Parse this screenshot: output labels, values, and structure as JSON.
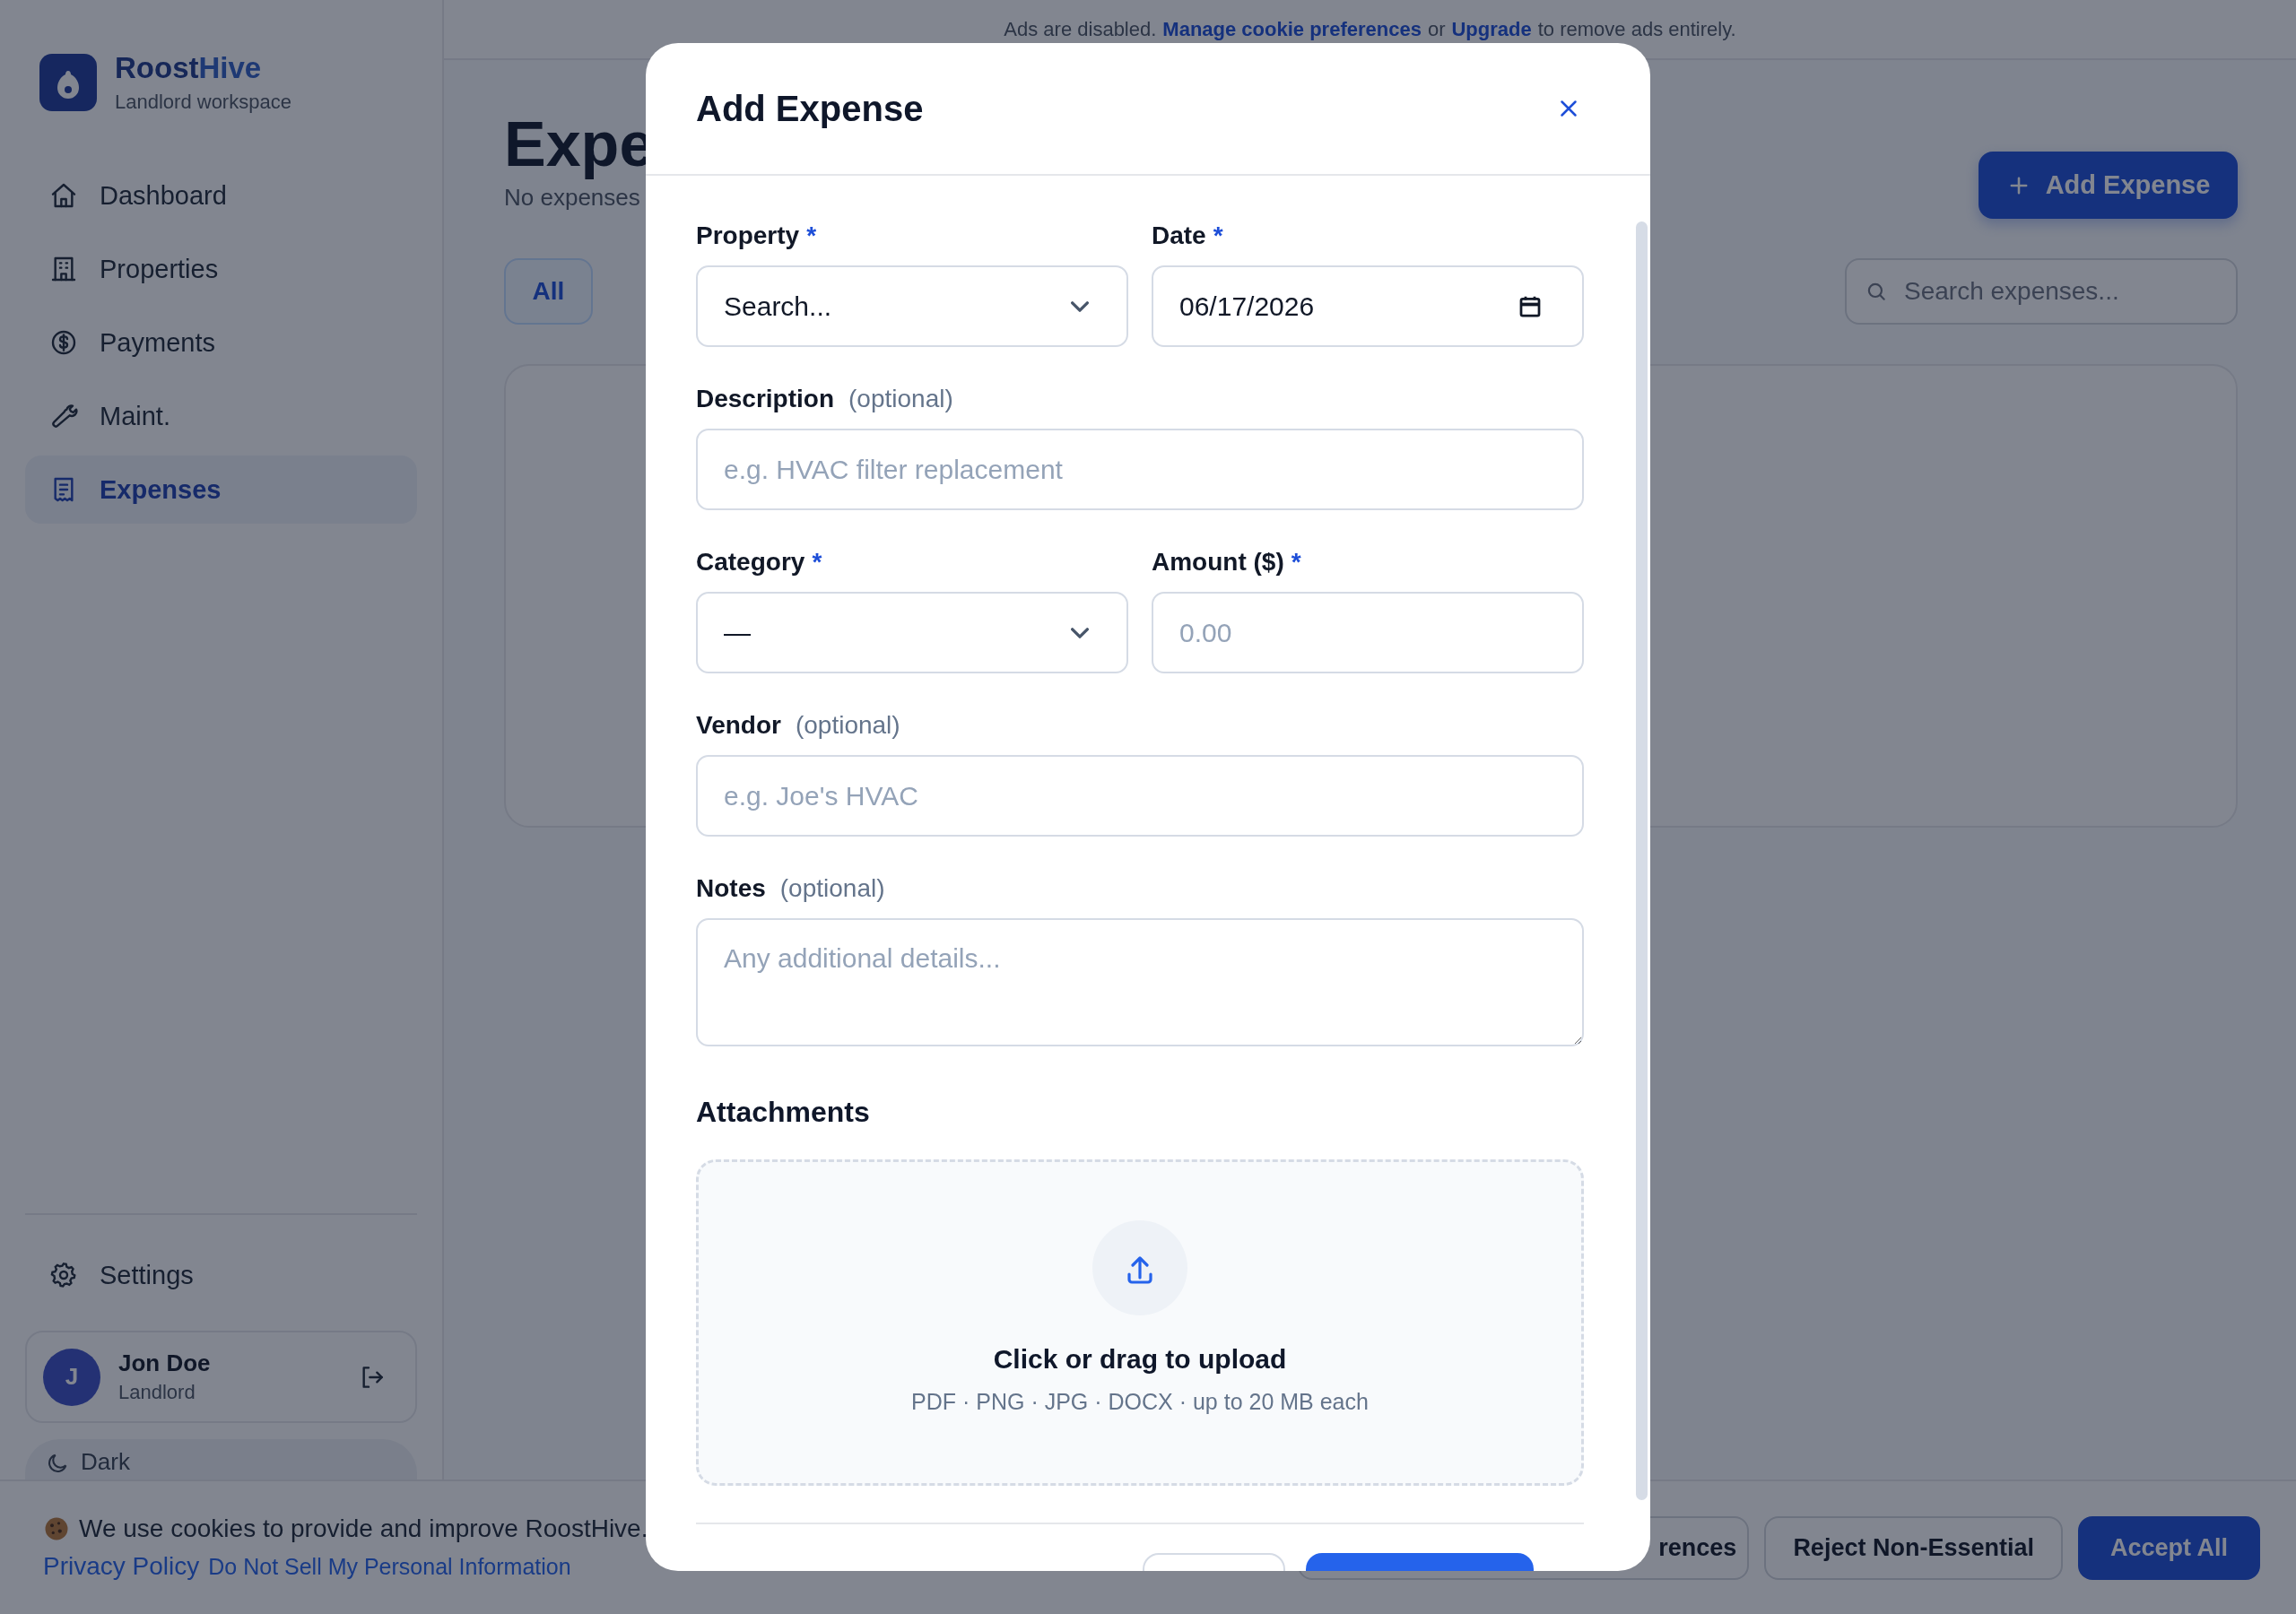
{
  "top_banner": {
    "parts": [
      {
        "kind": "text",
        "text": "Ads are disabled."
      },
      {
        "kind": "link",
        "text": "Manage cookie preferences"
      },
      {
        "kind": "text",
        "text": "or"
      },
      {
        "kind": "link",
        "text": "Upgrade"
      },
      {
        "kind": "text",
        "text": "to remove ads entirely."
      }
    ]
  },
  "sidebar": {
    "brand": {
      "name": "Roost",
      "name_accent": "Hive",
      "subtitle": "Landlord workspace"
    },
    "items": [
      {
        "label": "Dashboard",
        "selected": false
      },
      {
        "label": "Properties",
        "selected": false
      },
      {
        "label": "Payments",
        "selected": false
      },
      {
        "label": "Maint.",
        "selected": false
      },
      {
        "label": "Expenses",
        "selected": true
      }
    ],
    "settings": {
      "label": "Settings"
    },
    "user": {
      "initial": "J",
      "name": "Jon Doe",
      "role": "Landlord"
    },
    "theme_toggle": {
      "label": "Dark"
    }
  },
  "page": {
    "title": "Expe",
    "subtitle": "No expenses",
    "add_button": "Add Expense",
    "filter_tabs": [
      {
        "label": "All",
        "selected": true
      }
    ],
    "search": {
      "placeholder": "Search expenses..."
    }
  },
  "modal": {
    "title": "Add Expense",
    "rows": [
      [
        {
          "kind": "select",
          "label": "Property",
          "required_mark": "*",
          "value": "Search..."
        },
        {
          "kind": "date",
          "label": "Date",
          "required_mark": "*",
          "value": "06/17/2026"
        }
      ],
      [
        {
          "kind": "text",
          "label": "Description",
          "hint": "(optional)",
          "placeholder": "e.g. HVAC filter replacement"
        }
      ],
      [
        {
          "kind": "select",
          "label": "Category",
          "required_mark": "*",
          "value": "—"
        },
        {
          "kind": "text",
          "label": "Amount ($)",
          "required_mark": "*",
          "placeholder": "0.00"
        }
      ],
      [
        {
          "kind": "text",
          "label": "Vendor",
          "hint": "(optional)",
          "placeholder": "e.g. Joe's HVAC"
        }
      ],
      [
        {
          "kind": "textarea",
          "label": "Notes",
          "hint": "(optional)",
          "placeholder": "Any additional details..."
        }
      ]
    ],
    "attachments": {
      "heading": "Attachments",
      "title": "Click or drag to upload",
      "hint": "PDF · PNG · JPG · DOCX · up to 20 MB each"
    }
  },
  "cookie_bar": {
    "text": "We use cookies to provide and improve RoostHive.",
    "links": [
      "Privacy Policy",
      "Do Not Sell My Personal Information"
    ],
    "buttons": [
      {
        "label": "rences",
        "kind": "outline"
      },
      {
        "label": "Reject Non-Essential",
        "kind": "outline"
      },
      {
        "label": "Accept All",
        "kind": "primary"
      }
    ]
  }
}
